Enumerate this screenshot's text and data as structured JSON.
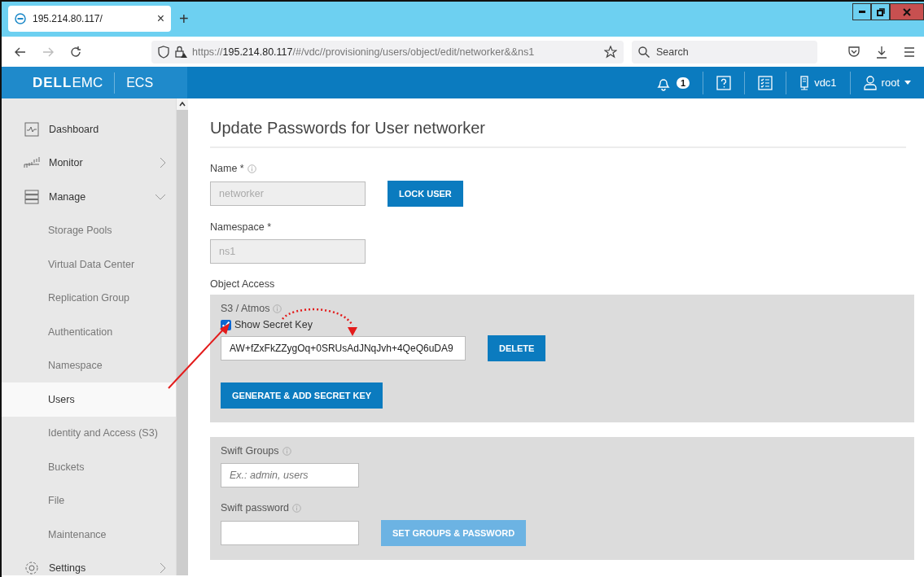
{
  "browser": {
    "tab": {
      "title": "195.214.80.117/",
      "close": "×"
    },
    "new_tab": "+",
    "url": {
      "scheme": "https://",
      "host": "195.214.80.117",
      "path": "/#/vdc//provisioning/users/object/edit/networker&&ns1"
    },
    "search": {
      "placeholder": "Search"
    }
  },
  "header": {
    "logo_dell": "DELL",
    "logo_emc": "EMC",
    "product": "ECS",
    "notifications": "1",
    "vdc": "vdc1",
    "user": "root"
  },
  "sidebar": {
    "items": [
      {
        "label": "Dashboard",
        "kind": "dashboard",
        "selected": false
      },
      {
        "label": "Monitor",
        "kind": "monitor",
        "expanded": false,
        "selected": false
      },
      {
        "label": "Manage",
        "kind": "manage",
        "expanded": true,
        "selected": false,
        "children": [
          {
            "label": "Storage Pools",
            "selected": false
          },
          {
            "label": "Virtual Data Center",
            "selected": false
          },
          {
            "label": "Replication Group",
            "selected": false
          },
          {
            "label": "Authentication",
            "selected": false
          },
          {
            "label": "Namespace",
            "selected": false
          },
          {
            "label": "Users",
            "selected": true
          },
          {
            "label": "Identity and Access (S3)",
            "selected": false
          },
          {
            "label": "Buckets",
            "selected": false
          },
          {
            "label": "File",
            "selected": false
          },
          {
            "label": "Maintenance",
            "selected": false
          }
        ]
      },
      {
        "label": "Settings",
        "kind": "settings",
        "expanded": false,
        "selected": false
      }
    ]
  },
  "form": {
    "title": "Update Passwords for User networker",
    "name": {
      "label": "Name *",
      "value": "networker",
      "disabled": true
    },
    "lock_button": "LOCK USER",
    "namespace": {
      "label": "Namespace *",
      "value": "ns1",
      "disabled": true
    },
    "object_access": "Object Access",
    "s3": {
      "label": "S3 / Atmos",
      "show_secret": {
        "label": "Show Secret Key",
        "checked": true
      },
      "secret_key": "AW+fZxFkZZygOq+0SRUsAdJNqJvh+4QeQ6uDA9",
      "delete_button": "DELETE",
      "generate_button": "GENERATE & ADD SECRET KEY"
    },
    "swift": {
      "groups_label": "Swift Groups",
      "groups_placeholder": "Ex.: admin, users",
      "password_label": "Swift password",
      "set_button": {
        "label": "SET GROUPS & PASSWORD",
        "disabled": true
      }
    }
  }
}
